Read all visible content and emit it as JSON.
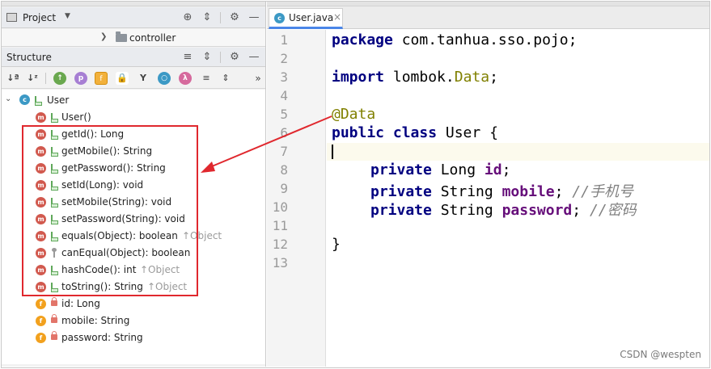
{
  "project_panel": {
    "title": "Project",
    "controller_folder": "controller"
  },
  "structure_panel": {
    "title": "Structure",
    "toolbar_icons": [
      "sort-by-visibility-icon",
      "sort-alphabetically-icon",
      "show-inherited-icon",
      "show-properties-icon",
      "show-fields-icon",
      "show-non-public-icon",
      "show-lambdas-icon",
      "show-anonymous-icon",
      "show-lambdas-2-icon",
      "expand-all-icon",
      "collapse-all-icon",
      "more-icon"
    ],
    "class_name": "User",
    "members": [
      {
        "label": "User()",
        "kind": "method",
        "visibility": "public",
        "inherited": ""
      },
      {
        "label": "getId(): Long",
        "kind": "method",
        "visibility": "public",
        "inherited": ""
      },
      {
        "label": "getMobile(): String",
        "kind": "method",
        "visibility": "public",
        "inherited": ""
      },
      {
        "label": "getPassword(): String",
        "kind": "method",
        "visibility": "public",
        "inherited": ""
      },
      {
        "label": "setId(Long): void",
        "kind": "method",
        "visibility": "public",
        "inherited": ""
      },
      {
        "label": "setMobile(String): void",
        "kind": "method",
        "visibility": "public",
        "inherited": ""
      },
      {
        "label": "setPassword(String): void",
        "kind": "method",
        "visibility": "public",
        "inherited": ""
      },
      {
        "label": "equals(Object): boolean",
        "kind": "method",
        "visibility": "public",
        "inherited": "↑Object"
      },
      {
        "label": "canEqual(Object): boolean",
        "kind": "method",
        "visibility": "package",
        "inherited": ""
      },
      {
        "label": "hashCode(): int",
        "kind": "method",
        "visibility": "public",
        "inherited": "↑Object"
      },
      {
        "label": "toString(): String",
        "kind": "method",
        "visibility": "public",
        "inherited": "↑Object"
      },
      {
        "label": "id: Long",
        "kind": "field",
        "visibility": "private",
        "inherited": ""
      },
      {
        "label": "mobile: String",
        "kind": "field",
        "visibility": "private",
        "inherited": ""
      },
      {
        "label": "password: String",
        "kind": "field",
        "visibility": "private",
        "inherited": ""
      }
    ]
  },
  "editor": {
    "tab_label": "User.java",
    "line_numbers": [
      "1",
      "2",
      "3",
      "4",
      "5",
      "6",
      "7",
      "8",
      "9",
      "10",
      "11",
      "12",
      "13"
    ],
    "lines": {
      "l1_kw": "package",
      "l1_rest": " com.tanhua.sso.pojo;",
      "l3_kw": "import",
      "l3_rest": " lombok.",
      "l3_cls": "Data",
      "l3_end": ";",
      "l5_ann": "@Data",
      "l6_kw": "public class",
      "l6_rest": " User {",
      "l8_kw": "private",
      "l8_type": " Long ",
      "l8_fld": "id",
      "l8_end": ";",
      "l9_kw": "private",
      "l9_type": " String ",
      "l9_fld": "mobile",
      "l9_end": "; ",
      "l9_cmt": "//手机号",
      "l10_kw": "private",
      "l10_type": " String ",
      "l10_fld": "password",
      "l10_end": "; ",
      "l10_cmt": "//密码",
      "l12": "}"
    }
  },
  "watermark": "CSDN @wespten",
  "colors": {
    "highlight_box": "#e0282e",
    "keyword": "#000080",
    "annotation": "#808000",
    "field": "#660e7a",
    "comment": "#808080",
    "method_badge": "#d1594e",
    "field_badge": "#f2a11e",
    "class_badge": "#3c99c5"
  }
}
